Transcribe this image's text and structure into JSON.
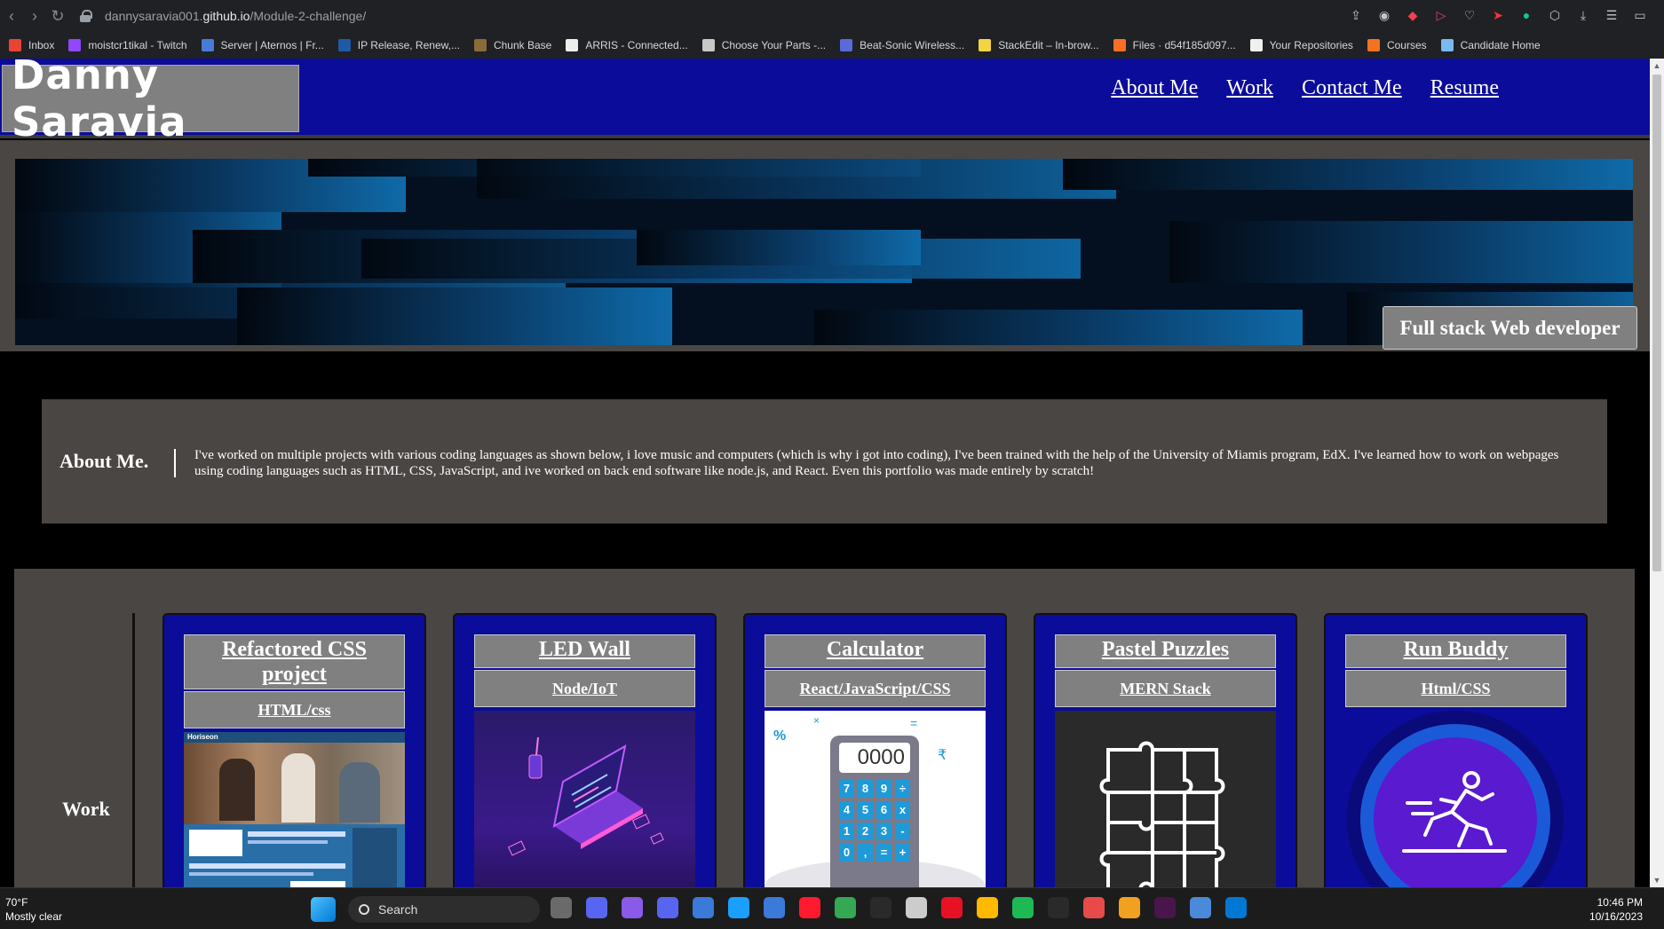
{
  "browser": {
    "url_prefix": "dannysaravia001.",
    "url_domain": "github.io",
    "url_path": "/Module-2-challenge/",
    "bookmarks": [
      {
        "label": "Inbox",
        "color": "#ea4335"
      },
      {
        "label": "moistcr1tikal - Twitch",
        "color": "#9146ff"
      },
      {
        "label": "Server | Aternos | Fr...",
        "color": "#4a7bd6"
      },
      {
        "label": "IP Release, Renew,...",
        "color": "#1e5aa8"
      },
      {
        "label": "Chunk Base",
        "color": "#8b6b3a"
      },
      {
        "label": "ARRIS - Connected...",
        "color": "#eeeeee"
      },
      {
        "label": "Choose Your Parts -...",
        "color": "#c8c8c8"
      },
      {
        "label": "Beat-Sonic Wireless...",
        "color": "#5a6ad8"
      },
      {
        "label": "StackEdit – In-brow...",
        "color": "#f5d442"
      },
      {
        "label": "Files · d54f185d097...",
        "color": "#fc6d26"
      },
      {
        "label": "Your Repositories",
        "color": "#f0f0f0"
      },
      {
        "label": "Courses",
        "color": "#f47321"
      },
      {
        "label": "Candidate Home",
        "color": "#7ab8f0"
      }
    ]
  },
  "site": {
    "logo": "Danny Saravia",
    "nav": [
      "About Me",
      "Work",
      "Contact Me",
      "Resume"
    ],
    "hero_badge": "Full stack Web developer",
    "about": {
      "heading": "About Me.",
      "text": "I've worked on multiple projects with various coding languages as shown below, i love music and computers (which is why i got into coding), I've been trained with the help of the University of Miamis program, EdX. I've learned how to work on webpages using coding languages such as HTML, CSS, JavaScript, and ive worked on back end software like node.js, and React. Even this portfolio was made entirely by scratch!"
    },
    "work": {
      "heading": "Work",
      "projects": [
        {
          "title": "Refactored CSS project",
          "tech": "HTML/css",
          "image": "horiseon-screenshot",
          "image_title": "Horiseon"
        },
        {
          "title": "LED Wall",
          "tech": "Node/IoT",
          "image": "isometric-laptop-illustration"
        },
        {
          "title": "Calculator",
          "tech": "React/JavaScript/CSS",
          "image": "calculator-illustration",
          "display": "0000",
          "keys": [
            "7",
            "8",
            "9",
            "÷",
            "4",
            "5",
            "6",
            "x",
            "1",
            "2",
            "3",
            "-",
            "0",
            ",",
            "=",
            "+"
          ]
        },
        {
          "title": "Pastel Puzzles",
          "tech": "MERN Stack",
          "image": "puzzle-pieces-icon"
        },
        {
          "title": "Run Buddy",
          "tech": "Html/CSS",
          "image": "runner-icon"
        }
      ]
    }
  },
  "taskbar": {
    "weather_temp": "70°F",
    "weather_desc": "Mostly clear",
    "search_label": "Search",
    "time": "10:46 PM",
    "date": "10/16/2023"
  },
  "colors": {
    "header_blue": "#0c0c9a",
    "panel_gray": "#4a4644",
    "button_gray": "#808080"
  }
}
